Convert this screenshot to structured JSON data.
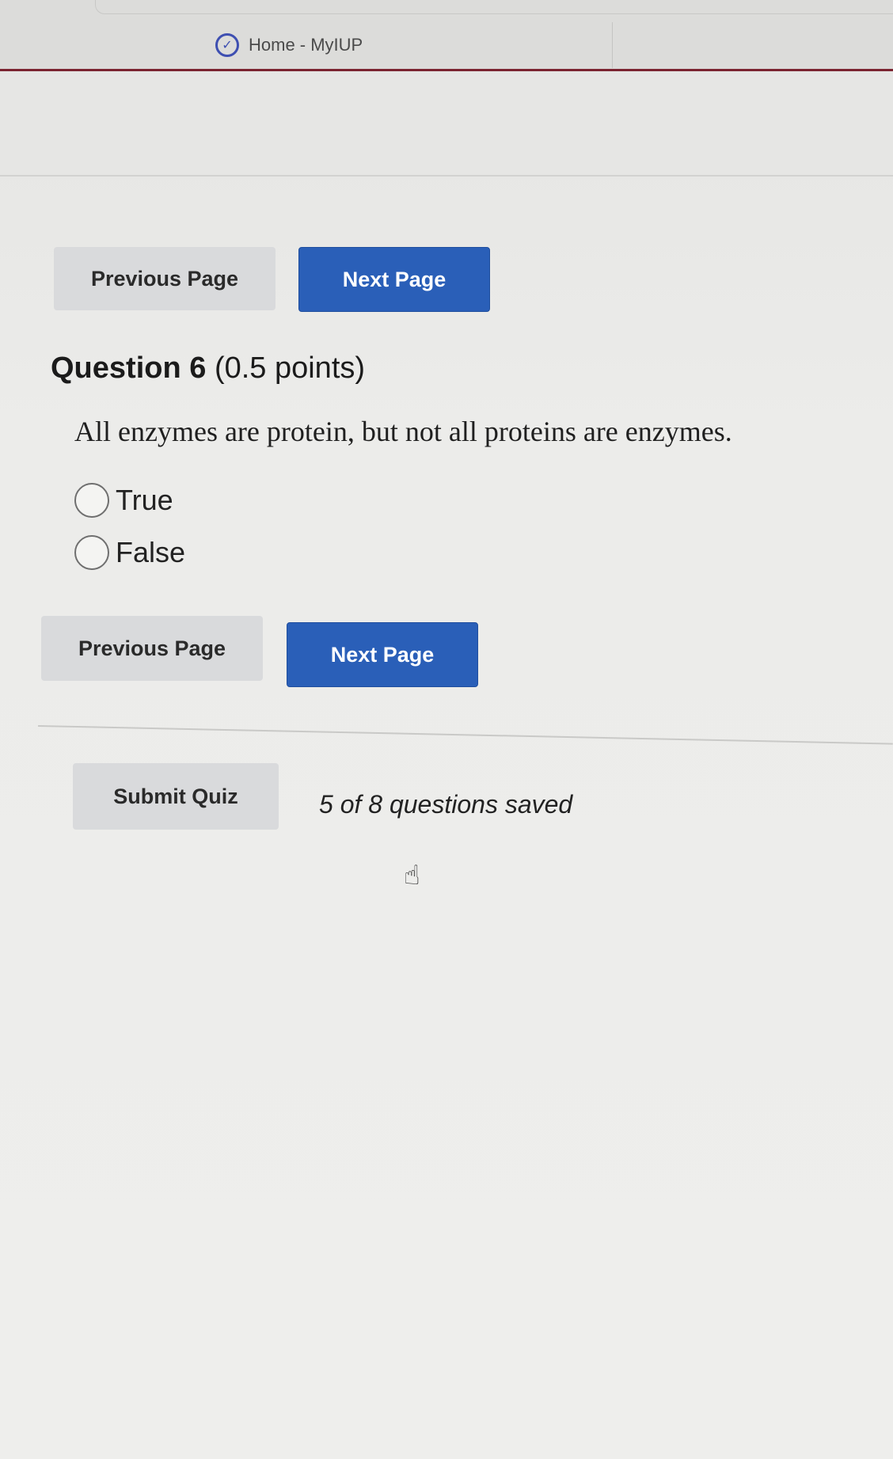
{
  "browser": {
    "tab_title": "Home - MyIUP",
    "tab_icon": "check-circle-icon"
  },
  "nav_top": {
    "previous_label": "Previous Page",
    "next_label": "Next Page"
  },
  "question": {
    "number_label": "Question 6",
    "points_label": "(0.5 points)",
    "text": "All enzymes are protein, but not all proteins are enzymes.",
    "options": [
      {
        "label": "True",
        "selected": false
      },
      {
        "label": "False",
        "selected": false
      }
    ]
  },
  "nav_bottom": {
    "previous_label": "Previous Page",
    "next_label": "Next Page"
  },
  "footer": {
    "submit_label": "Submit Quiz",
    "saved_status": "5 of 8 questions saved"
  },
  "colors": {
    "primary": "#2a5fb8",
    "secondary": "#d9dadc",
    "tab_accent": "#7b2430"
  }
}
